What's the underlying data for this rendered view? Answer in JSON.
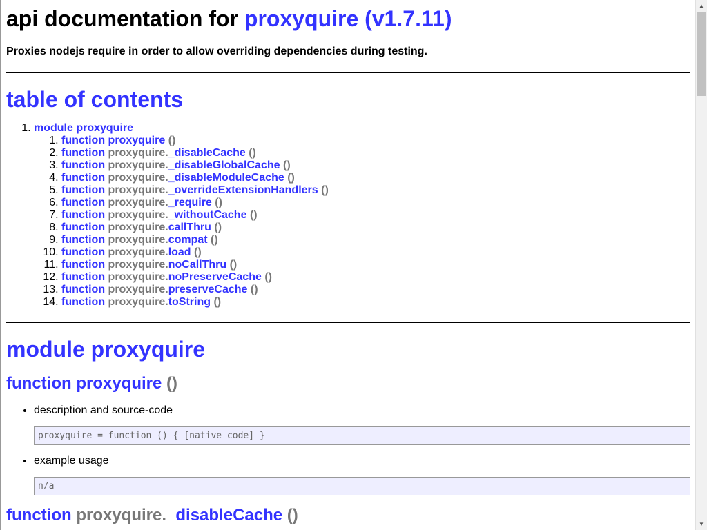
{
  "header": {
    "title_prefix": "api documentation for ",
    "title_link": "proxyquire (v1.7.11)",
    "subtitle": "Proxies nodejs require in order to allow overriding dependencies during testing."
  },
  "toc": {
    "heading": "table of contents",
    "module_label": "module proxyquire",
    "items": [
      {
        "kw": "function",
        "prefix": "",
        "name": "proxyquire",
        "parens": "()"
      },
      {
        "kw": "function",
        "prefix": "proxyquire.",
        "name": "_disableCache",
        "parens": "()"
      },
      {
        "kw": "function",
        "prefix": "proxyquire.",
        "name": "_disableGlobalCache",
        "parens": "()"
      },
      {
        "kw": "function",
        "prefix": "proxyquire.",
        "name": "_disableModuleCache",
        "parens": "()"
      },
      {
        "kw": "function",
        "prefix": "proxyquire.",
        "name": "_overrideExtensionHandlers",
        "parens": "()"
      },
      {
        "kw": "function",
        "prefix": "proxyquire.",
        "name": "_require",
        "parens": "()"
      },
      {
        "kw": "function",
        "prefix": "proxyquire.",
        "name": "_withoutCache",
        "parens": "()"
      },
      {
        "kw": "function",
        "prefix": "proxyquire.",
        "name": "callThru",
        "parens": "()"
      },
      {
        "kw": "function",
        "prefix": "proxyquire.",
        "name": "compat",
        "parens": "()"
      },
      {
        "kw": "function",
        "prefix": "proxyquire.",
        "name": "load",
        "parens": "()"
      },
      {
        "kw": "function",
        "prefix": "proxyquire.",
        "name": "noCallThru",
        "parens": "()"
      },
      {
        "kw": "function",
        "prefix": "proxyquire.",
        "name": "noPreserveCache",
        "parens": "()"
      },
      {
        "kw": "function",
        "prefix": "proxyquire.",
        "name": "preserveCache",
        "parens": "()"
      },
      {
        "kw": "function",
        "prefix": "proxyquire.",
        "name": "toString",
        "parens": "()"
      }
    ]
  },
  "module_section": {
    "heading": "module proxyquire",
    "fn1": {
      "kw": "function",
      "name": "proxyquire",
      "parens": "()",
      "desc_label": "description and source-code",
      "source": "proxyquire = function () { [native code] }",
      "example_label": "example usage",
      "example": "n/a"
    },
    "fn2": {
      "kw": "function",
      "prefix": "proxyquire.",
      "name": "_disableCache",
      "parens": "()"
    }
  },
  "colors": {
    "link": "#3333ff",
    "grey": "#777777",
    "code_bg": "#eeeeff"
  }
}
